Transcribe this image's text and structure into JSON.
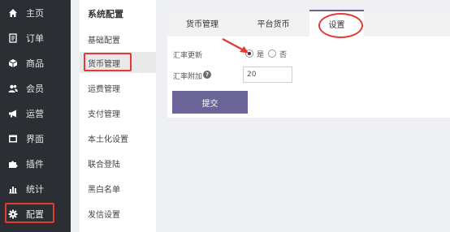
{
  "nav": {
    "items": [
      {
        "label": "主页",
        "icon": "home-icon"
      },
      {
        "label": "订单",
        "icon": "order-icon"
      },
      {
        "label": "商品",
        "icon": "cube-icon"
      },
      {
        "label": "会员",
        "icon": "users-icon"
      },
      {
        "label": "运营",
        "icon": "megaphone-icon"
      },
      {
        "label": "界面",
        "icon": "layout-icon"
      },
      {
        "label": "插件",
        "icon": "puzzle-icon"
      },
      {
        "label": "统计",
        "icon": "bar-chart-icon"
      },
      {
        "label": "配置",
        "icon": "gear-icon",
        "active": true
      }
    ]
  },
  "submenu": {
    "title": "系统配置",
    "items": [
      {
        "label": "基础配置"
      },
      {
        "label": "货币管理",
        "active": true
      },
      {
        "label": "运费管理"
      },
      {
        "label": "支付管理"
      },
      {
        "label": "本土化设置"
      },
      {
        "label": "联合登陆"
      },
      {
        "label": "黑白名单"
      },
      {
        "label": "发信设置"
      }
    ]
  },
  "tabs": [
    {
      "label": "货币管理"
    },
    {
      "label": "平台货币"
    },
    {
      "label": "设置",
      "active": true
    }
  ],
  "form": {
    "rate_update_label": "汇率更新",
    "option_yes": "是",
    "option_no": "否",
    "selected": "是",
    "rate_add_label": "汇率附加",
    "rate_add_value": "20",
    "help_glyph": "?",
    "submit_label": "提交"
  },
  "colors": {
    "nav_bg": "#2b2f33",
    "accent": "#6a6498",
    "highlight_red": "#e53935"
  }
}
